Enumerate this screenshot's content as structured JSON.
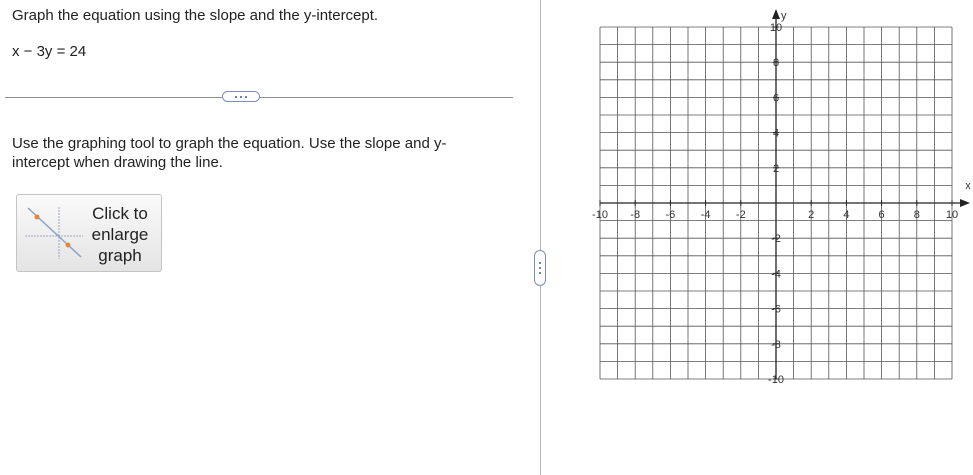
{
  "question": {
    "prompt": "Graph the equation using the slope and the y-intercept.",
    "equation": "x − 3y = 24",
    "more_button_label": "...",
    "instructions": "Use the graphing tool to graph the equation.  Use the slope and y-intercept when drawing the line."
  },
  "enlarge_button": {
    "line1": "Click to",
    "line2": "enlarge",
    "line3": "graph",
    "icon": "graph-thumbnail-icon"
  },
  "side_handle": {
    "icon": "ellipsis-vertical-icon"
  },
  "graph": {
    "xmin": -10,
    "xmax": 10,
    "ymin": -10,
    "ymax": 10,
    "grid_step": 1,
    "label_step": 2,
    "x_axis_label": "x",
    "y_axis_label": "y",
    "x_tick_labels": [
      "-10",
      "-8",
      "-6",
      "-4",
      "-2",
      "2",
      "4",
      "6",
      "8",
      "10"
    ],
    "y_tick_labels": [
      "10",
      "8",
      "6",
      "4",
      "2",
      "-2",
      "-4",
      "-6",
      "-8",
      "-10"
    ],
    "grid_color": "#555555",
    "axis_color": "#222222"
  },
  "colors": {
    "accent_border": "#7a8eb8",
    "dot_blue": "#3b5aa4",
    "thumb_point_orange": "#e08a3c"
  }
}
